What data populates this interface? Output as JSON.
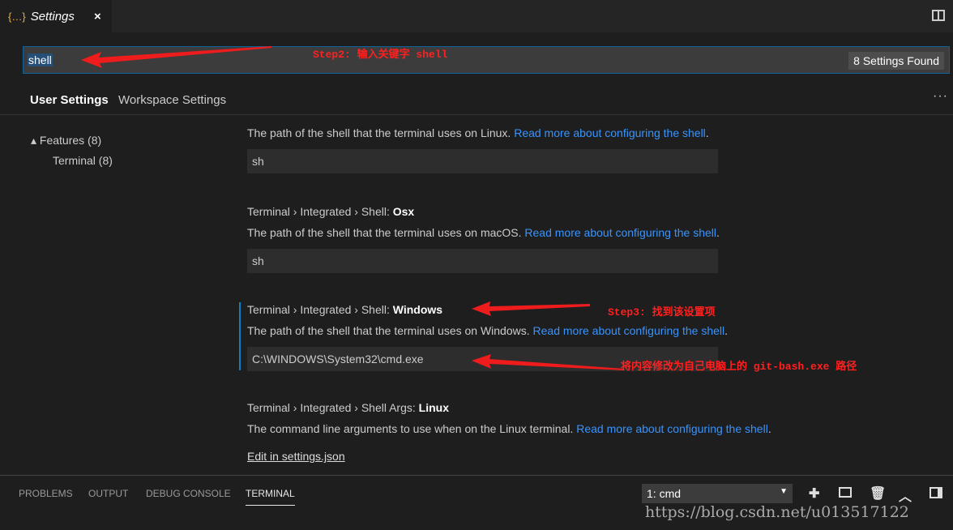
{
  "tab": {
    "icon": "json-braces-icon",
    "title": "Settings",
    "close": "×"
  },
  "search": {
    "value": "shell",
    "found": "8 Settings Found"
  },
  "settings_tabs": [
    "User Settings",
    "Workspace Settings"
  ],
  "more": "···",
  "toc": [
    "▴ Features (8)",
    "Terminal (8)"
  ],
  "settings": [
    {
      "desc": "The path of the shell that the terminal uses on Linux. ",
      "link": "Read more about configuring the shell",
      "value": "sh"
    },
    {
      "prefix": "Terminal › Integrated › Shell: ",
      "name": "Osx",
      "desc": "The path of the shell that the terminal uses on macOS. ",
      "link": "Read more about configuring the shell",
      "value": "sh"
    },
    {
      "prefix": "Terminal › Integrated › Shell: ",
      "name": "Windows",
      "desc": "The path of the shell that the terminal uses on Windows. ",
      "link": "Read more about configuring the shell",
      "value": "C:\\WINDOWS\\System32\\cmd.exe"
    },
    {
      "prefix": "Terminal › Integrated › Shell Args: ",
      "name": "Linux",
      "desc": "The command line arguments to use when on the Linux terminal. ",
      "link": "Read more about configuring the shell"
    }
  ],
  "edit_link": "Edit in settings.json",
  "panel": {
    "tabs": [
      "PROBLEMS",
      "OUTPUT",
      "DEBUG CONSOLE",
      "TERMINAL"
    ],
    "terminal_select": "1: cmd"
  },
  "annotations": {
    "step2": "Step2: 输入关键字 shell",
    "step3": "Step3: 找到该设置项",
    "step4": "将内容修改为自己电脑上的 git-bash.exe 路径",
    "color": "#ff2020"
  },
  "watermark": "https://blog.csdn.net/u013517122"
}
